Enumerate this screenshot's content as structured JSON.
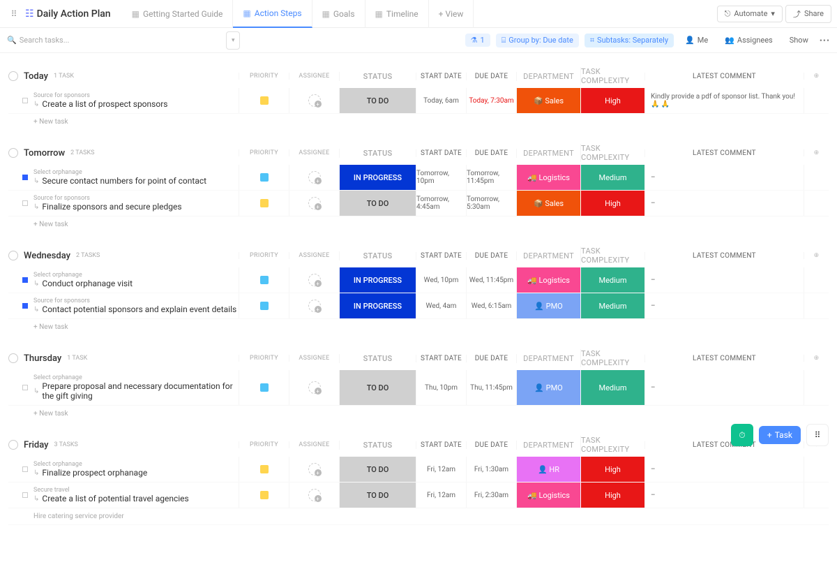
{
  "header": {
    "title": "Daily Action Plan",
    "tabs": [
      {
        "label": "Getting Started Guide"
      },
      {
        "label": "Action Steps"
      },
      {
        "label": "Goals"
      },
      {
        "label": "Timeline"
      }
    ],
    "addView": "+ View",
    "automate": "Automate",
    "share": "Share"
  },
  "filters": {
    "searchPlaceholder": "Search tasks...",
    "count": "1",
    "groupBy": "Group by: Due date",
    "subtasks": "Subtasks: Separately",
    "me": "Me",
    "assignees": "Assignees",
    "show": "Show"
  },
  "columns": {
    "priority": "PRIORITY",
    "assignee": "ASSIGNEE",
    "status": "STATUS",
    "start": "START DATE",
    "due": "DUE DATE",
    "dept": "DEPARTMENT",
    "complex": "TASK COMPLEXITY",
    "comment": "LATEST COMMENT"
  },
  "newTask": "+ New task",
  "groups": [
    {
      "name": "Today",
      "count": "1 TASK",
      "tasks": [
        {
          "parent": "Source for sponsors",
          "name": "Create a list of prospect sponsors",
          "flag": "yellow",
          "status": "TO DO",
          "statusCls": "status-todo",
          "start": "Today, 6am",
          "due": "Today, 7:30am",
          "dueRed": true,
          "dept": "📦 Sales",
          "deptCls": "dept-sales",
          "cx": "High",
          "cxCls": "cx-high",
          "comment": "Kindly provide a pdf of sponsor list. Thank you! 🙏 🙏",
          "dot": ""
        }
      ]
    },
    {
      "name": "Tomorrow",
      "count": "2 TASKS",
      "tasks": [
        {
          "parent": "Select orphanage",
          "name": "Secure contact numbers for point of contact",
          "flag": "cyan",
          "status": "IN PROGRESS",
          "statusCls": "status-inprogress",
          "start": "Tomorrow, 10pm",
          "due": "Tomorrow, 11:45pm",
          "dept": "🚚 Logistics",
          "deptCls": "dept-logistics",
          "cx": "Medium",
          "cxCls": "cx-medium",
          "comment": "–",
          "dot": "blue"
        },
        {
          "parent": "Source for sponsors",
          "name": "Finalize sponsors and secure pledges",
          "flag": "yellow",
          "status": "TO DO",
          "statusCls": "status-todo",
          "start": "Tomorrow, 4:45am",
          "due": "Tomorrow, 5:30am",
          "dept": "📦 Sales",
          "deptCls": "dept-sales",
          "cx": "High",
          "cxCls": "cx-high",
          "comment": "–",
          "dot": ""
        }
      ]
    },
    {
      "name": "Wednesday",
      "count": "2 TASKS",
      "tasks": [
        {
          "parent": "Select orphanage",
          "name": "Conduct orphanage visit",
          "flag": "cyan",
          "status": "IN PROGRESS",
          "statusCls": "status-inprogress",
          "start": "Wed, 10pm",
          "due": "Wed, 11:45pm",
          "dept": "🚚 Logistics",
          "deptCls": "dept-logistics",
          "cx": "Medium",
          "cxCls": "cx-medium",
          "comment": "–",
          "dot": "blue"
        },
        {
          "parent": "Source for sponsors",
          "name": "Contact potential sponsors and explain event details",
          "flag": "cyan",
          "status": "IN PROGRESS",
          "statusCls": "status-inprogress",
          "start": "Wed, 4am",
          "due": "Wed, 6:15am",
          "dept": "👤 PMO",
          "deptCls": "dept-pmo",
          "cx": "Medium",
          "cxCls": "cx-medium",
          "comment": "–",
          "dot": "blue"
        }
      ]
    },
    {
      "name": "Thursday",
      "count": "1 TASK",
      "tasks": [
        {
          "parent": "Select orphanage",
          "name": "Prepare proposal and necessary documentation for the gift giving",
          "flag": "cyan",
          "status": "TO DO",
          "statusCls": "status-todo",
          "start": "Thu, 10pm",
          "due": "Thu, 11:45pm",
          "dept": "👤 PMO",
          "deptCls": "dept-pmo",
          "cx": "Medium",
          "cxCls": "cx-medium",
          "comment": "–",
          "dot": ""
        }
      ]
    },
    {
      "name": "Friday",
      "count": "3 TASKS",
      "tasks": [
        {
          "parent": "Select orphanage",
          "name": "Finalize prospect orphanage",
          "flag": "yellow",
          "status": "TO DO",
          "statusCls": "status-todo",
          "start": "Fri, 12am",
          "due": "Fri, 1:30am",
          "dept": "👤 HR",
          "deptCls": "dept-hr",
          "cx": "High",
          "cxCls": "cx-high",
          "comment": "–",
          "dot": ""
        },
        {
          "parent": "Secure travel",
          "name": "Create a list of potential travel agencies",
          "flag": "yellow",
          "status": "TO DO",
          "statusCls": "status-todo",
          "start": "Fri, 12am",
          "due": "Fri, 2:30am",
          "dept": "🚚 Logistics",
          "deptCls": "dept-logistics",
          "cx": "High",
          "cxCls": "cx-high",
          "comment": "–",
          "dot": ""
        },
        {
          "parent": "",
          "name": "Hire catering service provider",
          "flag": "",
          "status": "",
          "statusCls": "",
          "start": "",
          "due": "",
          "dept": "",
          "deptCls": "",
          "cx": "",
          "cxCls": "",
          "comment": "",
          "dot": "",
          "partial": true
        }
      ]
    }
  ],
  "fab": {
    "task": "Task"
  }
}
